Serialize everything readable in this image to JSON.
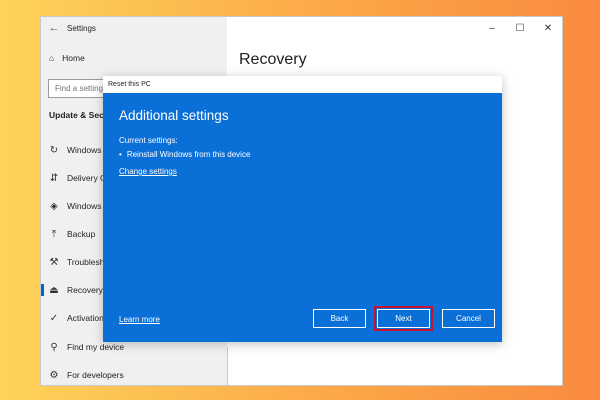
{
  "window": {
    "title": "Settings",
    "controls": {
      "minimize": "–",
      "maximize": "☐",
      "close": "✕"
    }
  },
  "sidebar": {
    "home_label": "Home",
    "search_placeholder": "Find a setting",
    "section_title": "Update & Security",
    "items": [
      {
        "label": "Windows Update",
        "icon": "refresh-icon"
      },
      {
        "label": "Delivery Optimization",
        "icon": "delivery-icon"
      },
      {
        "label": "Windows Security",
        "icon": "shield-icon"
      },
      {
        "label": "Backup",
        "icon": "upload-icon"
      },
      {
        "label": "Troubleshoot",
        "icon": "wrench-icon"
      },
      {
        "label": "Recovery",
        "icon": "recovery-icon"
      },
      {
        "label": "Activation",
        "icon": "check-circle-icon"
      },
      {
        "label": "Find my device",
        "icon": "person-location-icon"
      },
      {
        "label": "For developers",
        "icon": "developer-icon"
      }
    ]
  },
  "main": {
    "title": "Recovery"
  },
  "dialog": {
    "window_title": "Reset this PC",
    "heading": "Additional settings",
    "current_label": "Current settings:",
    "current_item": "Reinstall Windows from this device",
    "change_link": "Change settings",
    "learn_more": "Learn more",
    "buttons": {
      "back": "Back",
      "next": "Next",
      "cancel": "Cancel"
    },
    "highlight_color": "#c8102e",
    "background_color": "#0a6fd6"
  }
}
